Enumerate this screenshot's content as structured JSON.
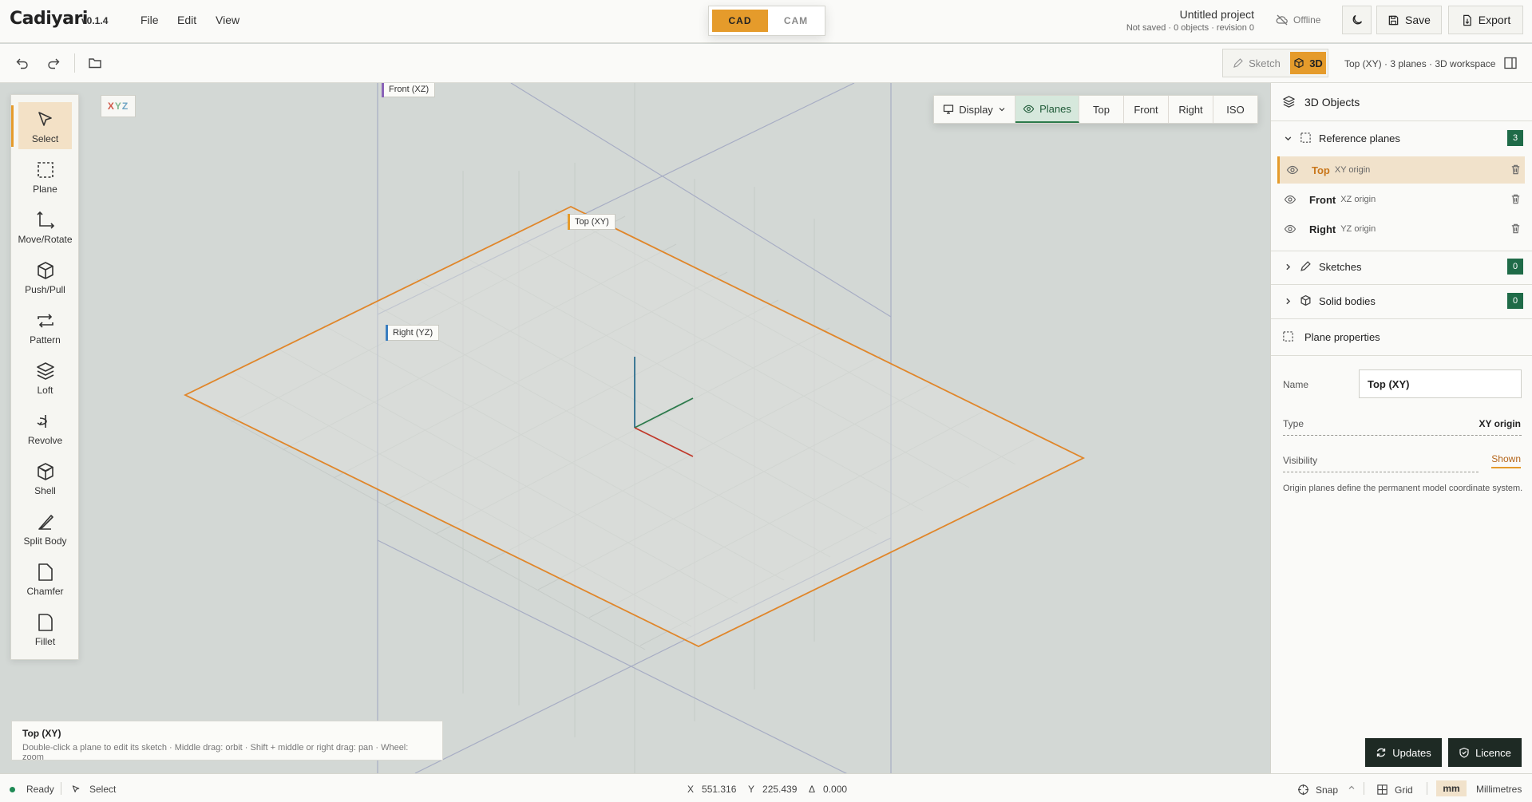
{
  "app": {
    "name": "Cadiyari",
    "version": "v0.1.4",
    "menus": [
      "File",
      "Edit",
      "View"
    ],
    "modes": {
      "cad": "CAD",
      "cam": "CAM"
    },
    "project_title": "Untitled project",
    "project_status": "Not saved · 0 objects · revision 0",
    "connection": "Offline",
    "save_label": "Save",
    "export_label": "Export"
  },
  "toolbar": {
    "sketch_label": "Sketch",
    "threed_label": "3D",
    "workspace_info": "Top (XY) · 3 planes · 3D workspace"
  },
  "viewport": {
    "axis_badge": {
      "x": "X",
      "y": "Y",
      "z": "Z"
    },
    "plane_tags": {
      "front": "Front (XZ)",
      "top": "Top (XY)",
      "right": "Right (YZ)"
    }
  },
  "tools": [
    {
      "label": "Select",
      "icon": "cursor-icon",
      "active": true
    },
    {
      "label": "Plane",
      "icon": "plane-icon"
    },
    {
      "label": "Move/Rotate",
      "icon": "move-icon"
    },
    {
      "label": "Push/Pull",
      "icon": "cube-icon"
    },
    {
      "label": "Pattern",
      "icon": "repeat-icon"
    },
    {
      "label": "Loft",
      "icon": "layers-icon"
    },
    {
      "label": "Revolve",
      "icon": "revolve-icon"
    },
    {
      "label": "Shell",
      "icon": "shell-icon"
    },
    {
      "label": "Split Body",
      "icon": "knife-icon"
    },
    {
      "label": "Chamfer",
      "icon": "chamfer-icon"
    },
    {
      "label": "Fillet",
      "icon": "fillet-icon"
    }
  ],
  "view_controls": {
    "display": "Display",
    "planes": "Planes",
    "top": "Top",
    "front": "Front",
    "right": "Right",
    "iso": "ISO"
  },
  "hint": {
    "title": "Top (XY)",
    "text": "Double-click a plane to edit its sketch · Middle drag: orbit · Shift + middle or right drag: pan · Wheel: zoom"
  },
  "panel": {
    "title": "3D Objects",
    "reference_planes": {
      "label": "Reference planes",
      "count": "3"
    },
    "planes": [
      {
        "name": "Top",
        "sub": "XY origin",
        "selected": true
      },
      {
        "name": "Front",
        "sub": "XZ origin"
      },
      {
        "name": "Right",
        "sub": "YZ origin"
      }
    ],
    "sketches": {
      "label": "Sketches",
      "count": "0"
    },
    "solid_bodies": {
      "label": "Solid bodies",
      "count": "0"
    },
    "properties": {
      "title": "Plane properties",
      "name_label": "Name",
      "name_value": "Top (XY)",
      "type_label": "Type",
      "type_value": "XY origin",
      "visibility_label": "Visibility",
      "visibility_value": "Shown",
      "description": "Origin planes define the permanent model coordinate system."
    },
    "updates_label": "Updates",
    "licence_label": "Licence"
  },
  "status": {
    "state": "Ready",
    "tool": "Select",
    "x_label": "X",
    "x_value": "551.316",
    "y_label": "Y",
    "y_value": "225.439",
    "delta_label": "Δ",
    "delta_value": "0.000",
    "snap": "Snap",
    "grid": "Grid",
    "unit_short": "mm",
    "unit_long": "Millimetres"
  },
  "colors": {
    "accent": "#e59b2b",
    "green": "#1f6b48",
    "axis_x": "#c0392b",
    "axis_y": "#2c7a4b",
    "axis_z": "#2e6f8e"
  }
}
